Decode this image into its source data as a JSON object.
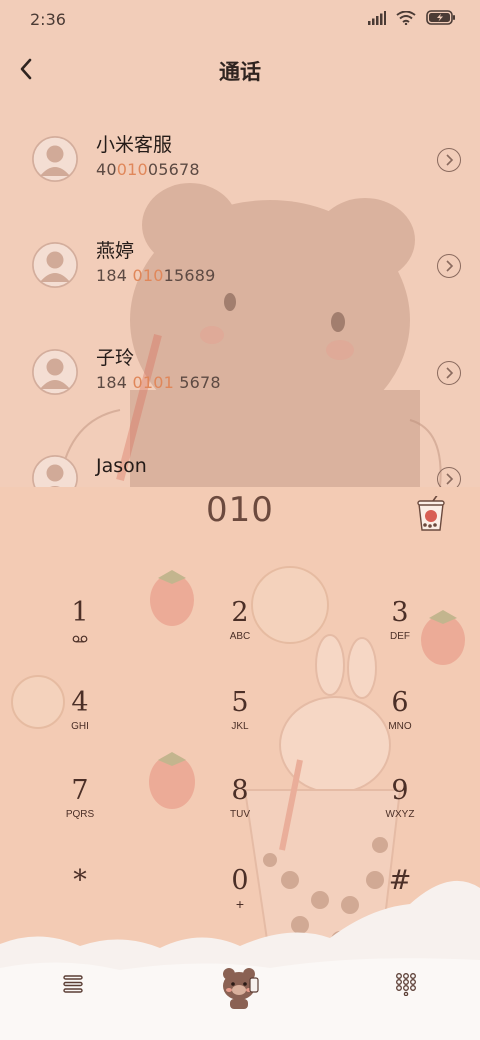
{
  "status_bar": {
    "time": "2:36"
  },
  "header": {
    "title": "通话"
  },
  "contacts": [
    {
      "name": "小米客服",
      "number_pre": "40",
      "number_hl": "010",
      "number_post": "05678"
    },
    {
      "name": "燕婷",
      "number_pre": "184 ",
      "number_hl": "010",
      "number_post": "15689"
    },
    {
      "name": "子玲",
      "number_pre": "184 ",
      "number_hl": "0101",
      "number_post": " 5678"
    },
    {
      "name": "Jason",
      "number_pre": "",
      "number_hl": "",
      "number_post": ""
    }
  ],
  "dialer": {
    "input": "010"
  },
  "keypad": [
    {
      "num": "1",
      "letters": ""
    },
    {
      "num": "2",
      "letters": "ABC"
    },
    {
      "num": "3",
      "letters": "DEF"
    },
    {
      "num": "4",
      "letters": "GHI"
    },
    {
      "num": "5",
      "letters": "JKL"
    },
    {
      "num": "6",
      "letters": "MNO"
    },
    {
      "num": "7",
      "letters": "PQRS"
    },
    {
      "num": "8",
      "letters": "TUV"
    },
    {
      "num": "9",
      "letters": "WXYZ"
    },
    {
      "num": "*",
      "letters": ""
    },
    {
      "num": "0",
      "letters": "+"
    },
    {
      "num": "#",
      "letters": ""
    }
  ],
  "colors": {
    "accent": "#e0875a",
    "background": "#f3cdb8",
    "text": "#3a2a24"
  }
}
